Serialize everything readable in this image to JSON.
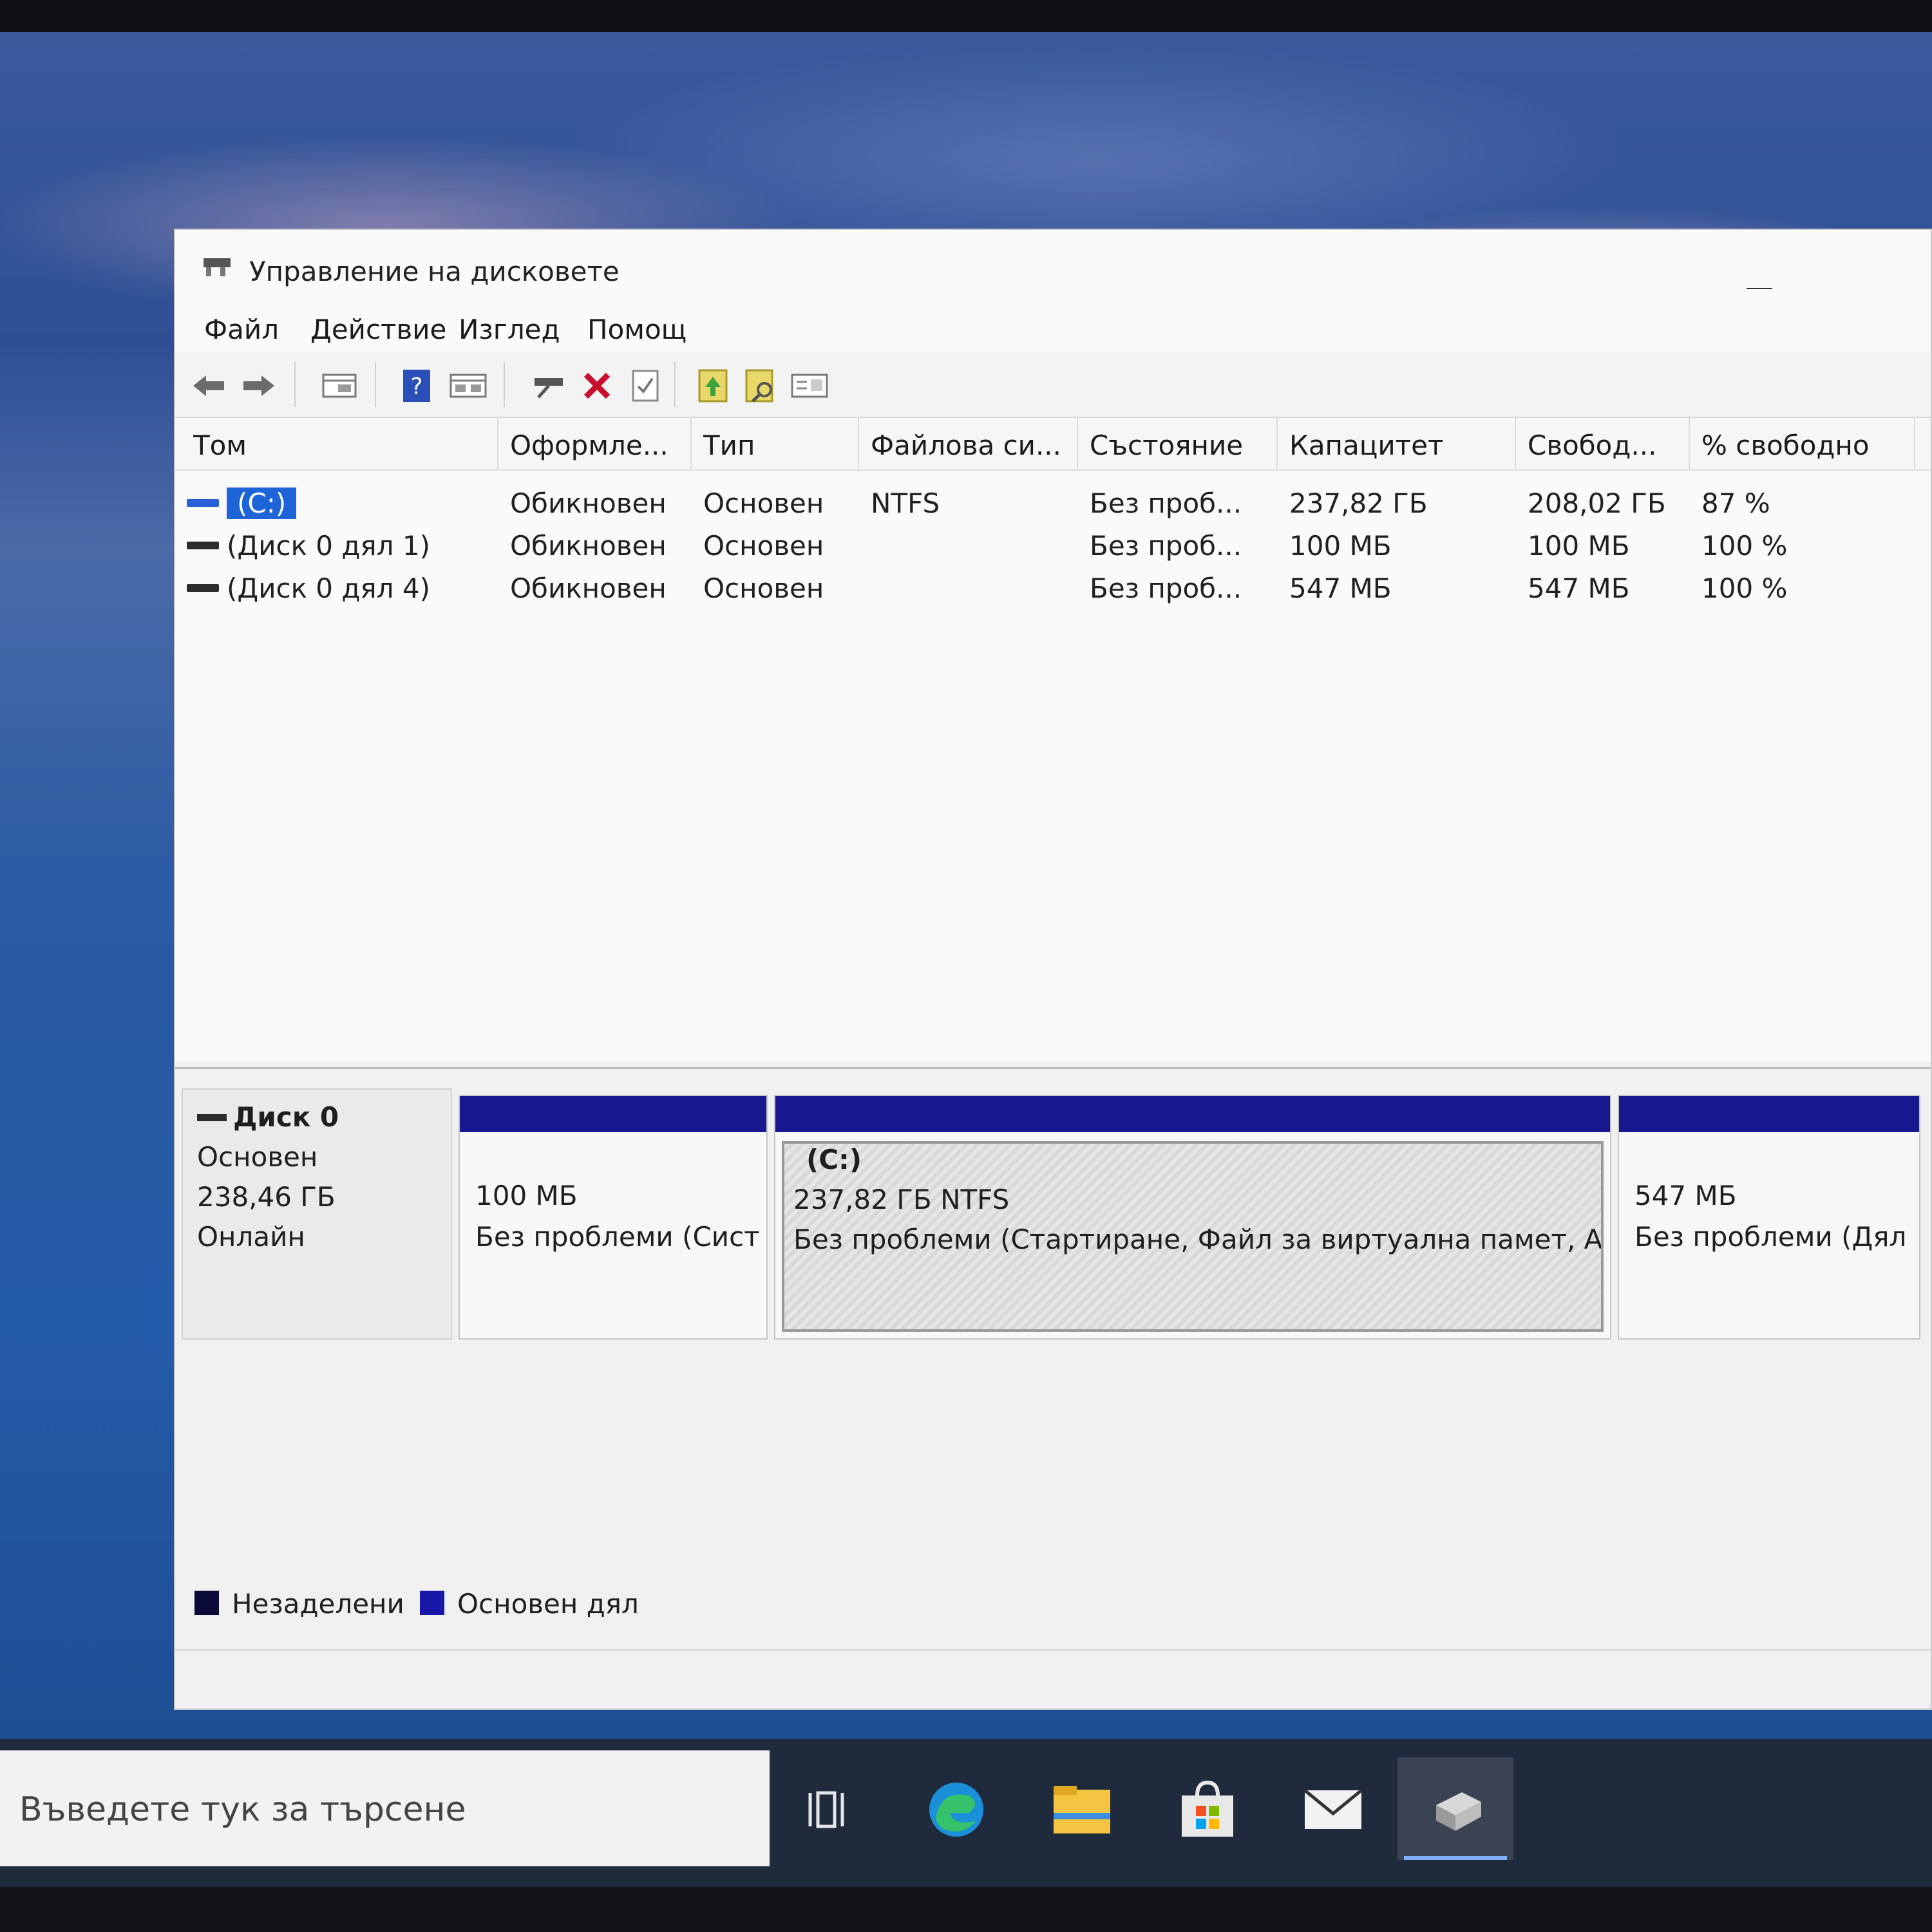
{
  "window": {
    "title": "Управление на дисковете",
    "menu": [
      "Файл",
      "Действие",
      "Изглед",
      "Помощ"
    ]
  },
  "toolbar": {
    "icons": [
      "back-arrow-icon",
      "forward-arrow-icon",
      "console-tree-icon",
      "help-icon",
      "properties-pane-icon",
      "connect-drive-icon",
      "delete-icon",
      "check-icon",
      "import-icon",
      "search-icon",
      "settings-panel-icon"
    ]
  },
  "volume_list": {
    "columns": [
      "Том",
      "Оформле...",
      "Тип",
      "Файлова си...",
      "Състояние",
      "Капацитет",
      "Свобод...",
      "% свободно"
    ],
    "rows": [
      {
        "volume": "(C:)",
        "layout": "Обикновен",
        "type": "Основен",
        "fs": "NTFS",
        "status": "Без проб...",
        "capacity": "237,82 ГБ",
        "free": "208,02 ГБ",
        "pct": "87 %"
      },
      {
        "volume": "(Диск 0 дял 1)",
        "layout": "Обикновен",
        "type": "Основен",
        "fs": "",
        "status": "Без проб...",
        "capacity": "100 МБ",
        "free": "100 МБ",
        "pct": "100 %"
      },
      {
        "volume": "(Диск 0 дял 4)",
        "layout": "Обикновен",
        "type": "Основен",
        "fs": "",
        "status": "Без проб...",
        "capacity": "547 МБ",
        "free": "547 МБ",
        "pct": "100 %"
      }
    ]
  },
  "disk": {
    "name": "Диск 0",
    "type": "Основен",
    "size": "238,46 ГБ",
    "state": "Онлайн",
    "partitions": [
      {
        "label": "",
        "size": "100 МБ",
        "status": "Без проблеми (Сист"
      },
      {
        "label": "(C:)",
        "size": "237,82 ГБ NTFS",
        "status": "Без проблеми (Стартиране, Файл за виртуална памет, Ава"
      },
      {
        "label": "",
        "size": "547 МБ",
        "status": "Без проблеми (Дял за в"
      }
    ]
  },
  "legend": {
    "unallocated": "Незаделени",
    "primary": "Основен дял",
    "colors": {
      "unallocated": "#0b0b3a",
      "primary": "#1717a8"
    }
  },
  "taskbar": {
    "search_placeholder": "Въведете тук за търсене",
    "apps": [
      "task-view-icon",
      "edge-icon",
      "file-explorer-icon",
      "store-icon",
      "mail-icon",
      "disk-management-icon"
    ]
  }
}
